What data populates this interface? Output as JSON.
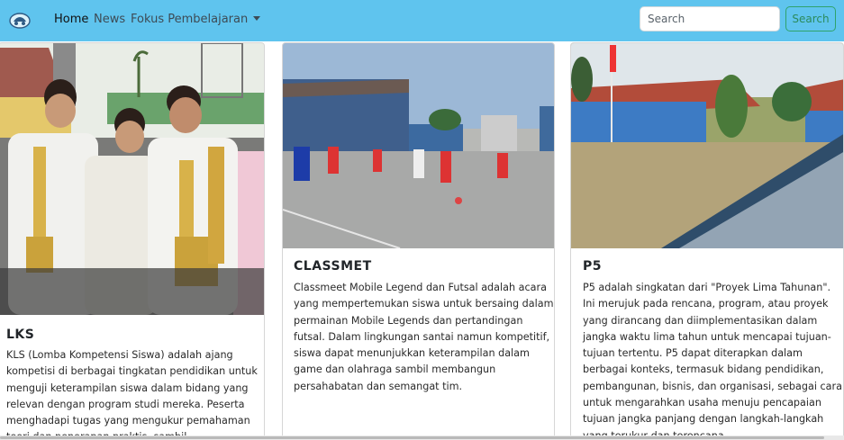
{
  "navbar": {
    "brand_icon": "car-logo-icon",
    "links": [
      "Home",
      "News",
      "Fokus Pembelajaran"
    ],
    "search_placeholder": "Search",
    "search_button": "Search",
    "bg_color": "#5fc4ee"
  },
  "cards": [
    {
      "title": "LKS",
      "text": "KLS (Lomba Kompetensi Siswa) adalah ajang kompetisi di berbagai tingkatan pendidikan untuk menguji keterampilan siswa dalam bidang yang relevan dengan program studi mereka. Peserta menghadapi tugas yang mengukur pemahaman teori dan penerapan praktis, sambil",
      "image": "students-holding-trophies-photo"
    },
    {
      "title": "CLASSMET",
      "text": "Classmeet Mobile Legend dan Futsal adalah acara yang mempertemukan siswa untuk bersaing dalam permainan Mobile Legends dan pertandingan futsal. Dalam lingkungan santai namun kompetitif, siswa dapat menunjukkan keterampilan dalam game dan olahraga sambil membangun persahabatan dan semangat tim.",
      "image": "futsal-match-courtyard-photo"
    },
    {
      "title": "P5",
      "text": "P5 adalah singkatan dari \"Proyek Lima Tahunan\". Ini merujuk pada rencana, program, atau proyek yang dirancang dan diimplementasikan dalam jangka waktu lima tahun untuk mencapai tujuan-tujuan tertentu. P5 dapat diterapkan dalam berbagai konteks, termasuk bidang pendidikan, pembangunan, bisnis, dan organisasi, sebagai cara untuk mengarahkan usaha menuju pencapaian tujuan jangka panjang dengan langkah-langkah yang terukur dan terencana",
      "image": "school-assembly-field-photo"
    }
  ]
}
